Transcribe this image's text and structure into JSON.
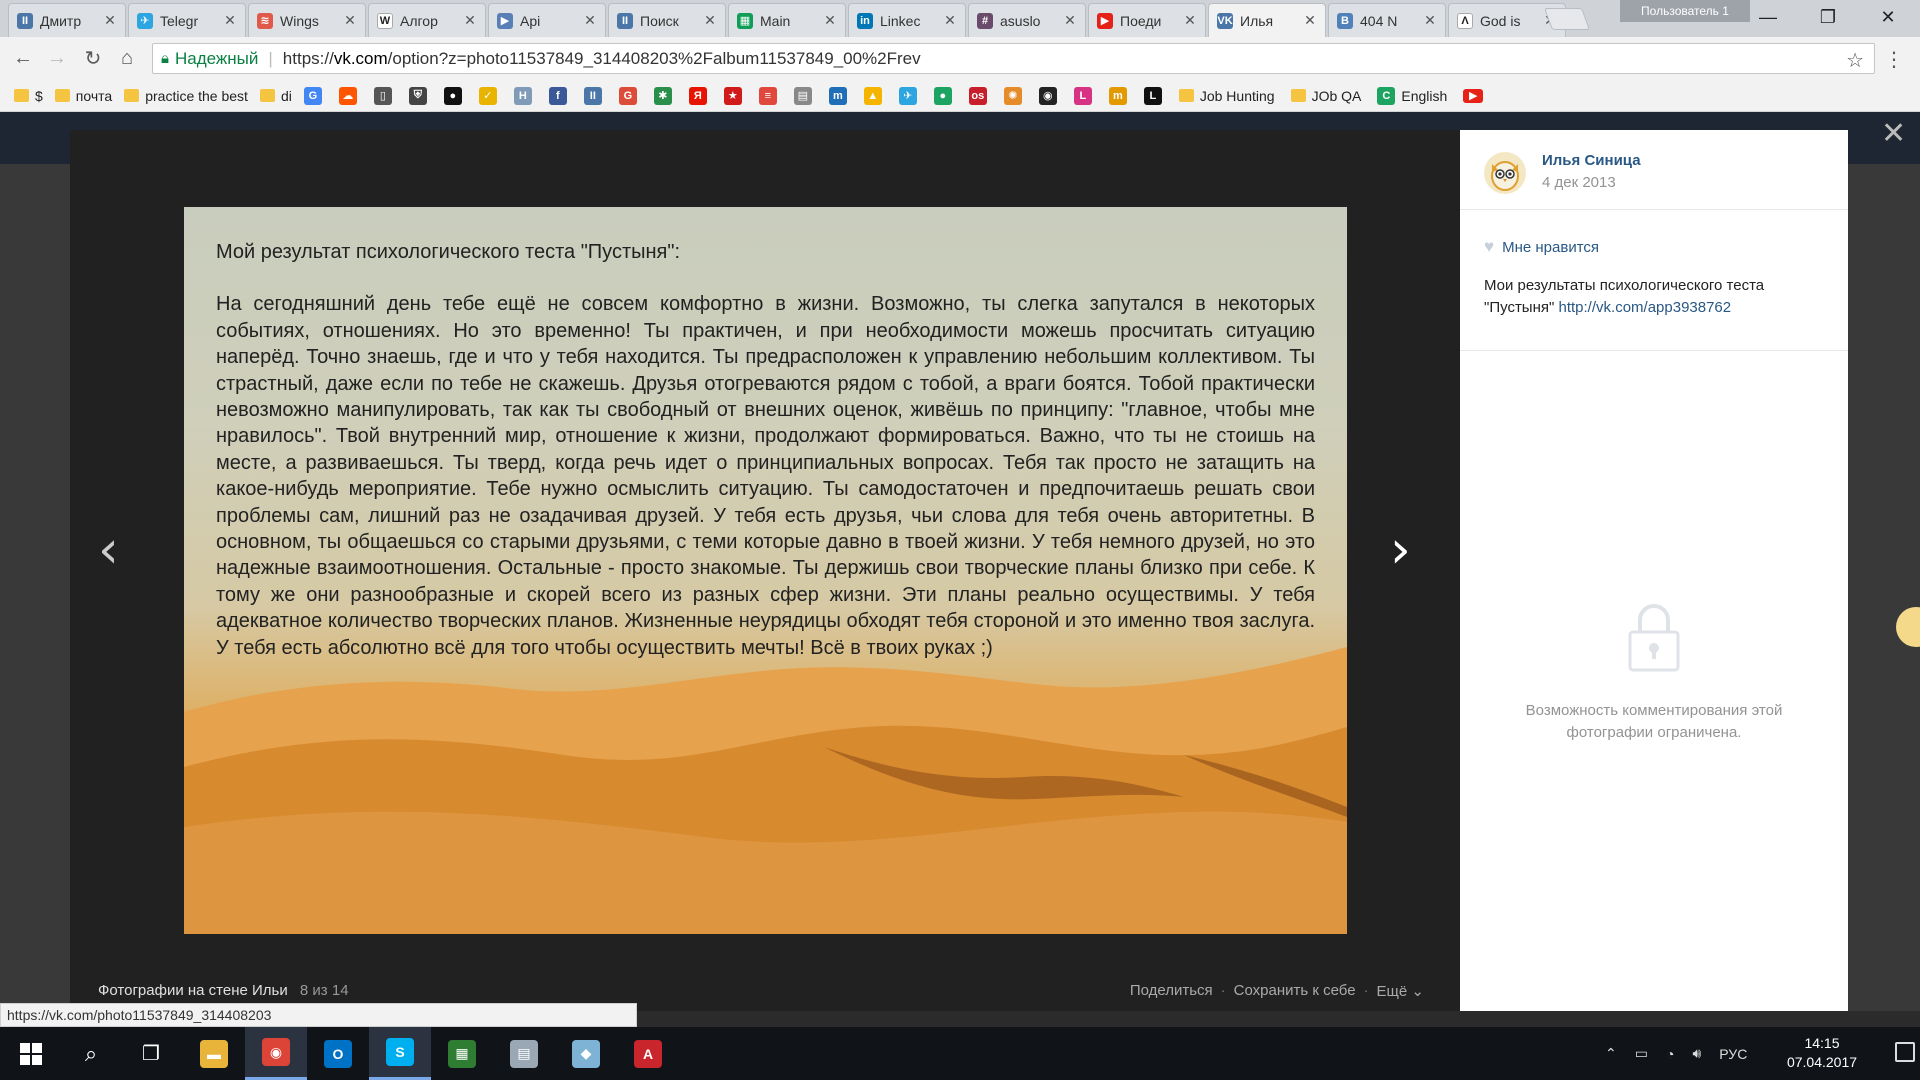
{
  "browser": {
    "tabs": [
      {
        "title": "Дмитр",
        "color": "#4a76a8",
        "glyph": "II"
      },
      {
        "title": "Telegr",
        "color": "#2ca5e0",
        "glyph": "✈"
      },
      {
        "title": "Wings",
        "color": "#e05a4c",
        "glyph": "≋"
      },
      {
        "title": "Алгор",
        "color": "#ffffff",
        "glyph": "W"
      },
      {
        "title": "Api",
        "color": "#5a7fb6",
        "glyph": "▶"
      },
      {
        "title": "Поиск",
        "color": "#4a76a8",
        "glyph": "II"
      },
      {
        "title": "Main",
        "color": "#0f9d58",
        "glyph": "▦"
      },
      {
        "title": "Linkec",
        "color": "#0077b5",
        "glyph": "in"
      },
      {
        "title": "asuslo",
        "color": "#6b4b6b",
        "glyph": "#"
      },
      {
        "title": "Поеди",
        "color": "#e62117",
        "glyph": "▶"
      },
      {
        "title": "Илья",
        "color": "#4a76a8",
        "glyph": "VK"
      },
      {
        "title": "404 N",
        "color": "#5181b8",
        "glyph": "B"
      },
      {
        "title": "God is",
        "color": "#ffffff",
        "glyph": "Λ"
      }
    ],
    "profile": "Пользователь 1",
    "secure_label": "Надежный",
    "url_scheme": "https://",
    "url_host": "vk.com",
    "url_rest": "/option?z=photo11537849_314408203%2Falbum11537849_00%2Frev",
    "status_url": "https://vk.com/photo11537849_314408203"
  },
  "bookmarks": {
    "folders": [
      "$",
      "почта",
      "practice the best",
      "di"
    ],
    "icons": [
      {
        "name": "translate-icon",
        "color": "#4285f4",
        "glyph": "G"
      },
      {
        "name": "soundcloud-icon",
        "color": "#ff5500",
        "glyph": "☁"
      },
      {
        "name": "doc-icon",
        "color": "#555555",
        "glyph": "▯"
      },
      {
        "name": "shield-icon",
        "color": "#444444",
        "glyph": "⛨"
      },
      {
        "name": "github-icon",
        "color": "#111111",
        "glyph": "●"
      },
      {
        "name": "check-icon",
        "color": "#e8b400",
        "glyph": "✓"
      },
      {
        "name": "h-icon",
        "color": "#7f9bb8",
        "glyph": "H"
      },
      {
        "name": "facebook-icon",
        "color": "#3b5998",
        "glyph": "f"
      },
      {
        "name": "pause-icon",
        "color": "#4a76a8",
        "glyph": "II"
      },
      {
        "name": "google-plus-icon",
        "color": "#dd4b39",
        "glyph": "G"
      },
      {
        "name": "puzzle-icon",
        "color": "#2a8f4a",
        "glyph": "✱"
      },
      {
        "name": "yandex-icon",
        "color": "#e61400",
        "glyph": "Я"
      },
      {
        "name": "star-icon",
        "color": "#d11a1a",
        "glyph": "★"
      },
      {
        "name": "stack-icon",
        "color": "#e0483e",
        "glyph": "≡"
      },
      {
        "name": "news-icon",
        "color": "#888888",
        "glyph": "▤"
      },
      {
        "name": "m-icon",
        "color": "#1e6fb8",
        "glyph": "m"
      },
      {
        "name": "drive-icon",
        "color": "#f4b400",
        "glyph": "▲"
      },
      {
        "name": "telegram-icon",
        "color": "#2ca5e0",
        "glyph": "✈"
      },
      {
        "name": "circle-icon",
        "color": "#1da462",
        "glyph": "●"
      },
      {
        "name": "ok-icon",
        "color": "#c81d2b",
        "glyph": "os"
      },
      {
        "name": "dots-icon",
        "color": "#e48b2a",
        "glyph": "✺"
      },
      {
        "name": "compass-icon",
        "color": "#222222",
        "glyph": "◉"
      },
      {
        "name": "l-red-icon",
        "color": "#d63384",
        "glyph": "L"
      },
      {
        "name": "m-orange-icon",
        "color": "#e39a00",
        "glyph": "m"
      },
      {
        "name": "l-black-icon",
        "color": "#111111",
        "glyph": "L"
      }
    ],
    "named": [
      {
        "label": "Job Hunting",
        "type": "folder"
      },
      {
        "label": "JOb QA",
        "type": "folder"
      },
      {
        "label": "English",
        "type": "icon",
        "color": "#1da462",
        "glyph": "C"
      }
    ],
    "youtube_color": "#e62117"
  },
  "photo": {
    "heading": "Мой результат психологического теста \"Пустыня\":",
    "body": "На сегодняшний день тебе ещё не совсем комфортно в жизни. Возможно, ты слегка запутался в некоторых событиях, отношениях. Но это временно! Ты практичен, и при необходимости можешь просчитать ситуацию наперёд. Точно знаешь, где и что у тебя находится. Ты предрасположен к управлению небольшим коллективом. Ты страстный, даже если по тебе не скажешь. Друзья отогреваются рядом с тобой, а враги боятся. Тобой практически невозможно манипулировать, так как ты свободный от внешних оценок, живёшь по принципу: \"главное, чтобы мне нравилось\". Твой внутренний мир, отношение к жизни, продолжают формироваться. Важно, что ты не стоишь на месте, а развиваешься. Ты тверд, когда речь идет о принципиальных вопросах. Тебя так просто не затащить на какое-нибудь мероприятие. Тебе нужно осмыслить ситуацию. Ты самодостаточен и предпочитаешь решать свои проблемы сам, лишний раз не озадачивая друзей. У тебя есть друзья, чьи слова для тебя очень авторитетны. В основном, ты общаешься со старыми друзьями, с теми которые давно в твоей жизни. У тебя немного друзей, но это надежные взаимоотношения. Остальные - просто знакомые. Ты держишь свои творческие планы близко при себе. К тому же они разнообразные и скорей всего из разных сфер жизни. Эти планы реально осуществимы. У тебя адекватное количество творческих планов. Жизненные неурядицы обходят тебя стороной и это именно твоя заслуга. У тебя есть абсолютно всё для того чтобы осуществить мечты! Всё в твоих руках ;)"
  },
  "viewer": {
    "album_title": "Фотографии на стене Ильи",
    "album_count": "8 из 14",
    "share": "Поделиться",
    "save": "Сохранить к себе",
    "more": "Ещё"
  },
  "sidebar": {
    "author": "Илья Синица",
    "date": "4 дек 2013",
    "like_label": "Мне нравится",
    "description": "Мои результаты психологического теста \"Пустыня\"",
    "link": "http://vk.com/app3938762",
    "comments_restricted": "Возможность комментирования этой фотографии ограничена."
  },
  "taskbar": {
    "apps": [
      {
        "name": "file-explorer-icon",
        "color": "#e8b43a",
        "glyph": "▬"
      },
      {
        "name": "chrome-icon",
        "color": "#db4437",
        "glyph": "◉"
      },
      {
        "name": "outlook-icon",
        "color": "#0072c6",
        "glyph": "O"
      },
      {
        "name": "skype-icon",
        "color": "#00aff0",
        "glyph": "S"
      },
      {
        "name": "spreadsheet-app-icon",
        "color": "#2e7d32",
        "glyph": "▦"
      },
      {
        "name": "document-app-icon",
        "color": "#9aa7b5",
        "glyph": "▤"
      },
      {
        "name": "notes-app-icon",
        "color": "#7fb3d5",
        "glyph": "◆"
      },
      {
        "name": "acrobat-icon",
        "color": "#c9252c",
        "glyph": "A"
      }
    ],
    "language": "РУС",
    "time": "14:15",
    "date": "07.04.2017"
  }
}
